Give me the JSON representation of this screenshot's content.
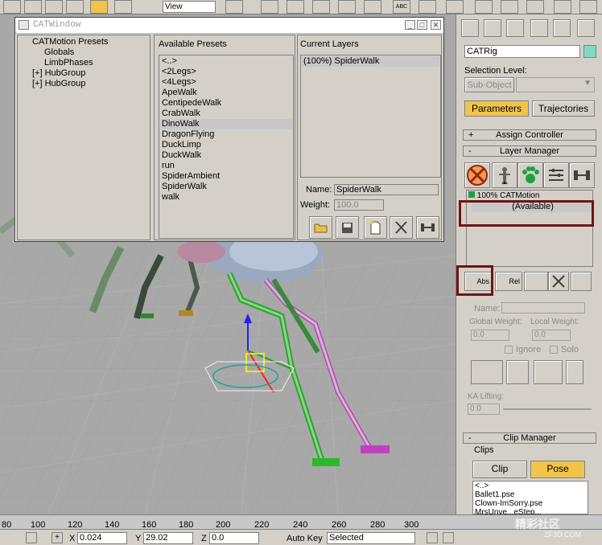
{
  "toolbar": {
    "view_combo": "View",
    "abc_label": "ABC"
  },
  "catwindow": {
    "title": "CATWindow",
    "minimize_icon": "minimize-icon",
    "maximize_icon": "maximize-icon",
    "close_icon": "close-icon",
    "tree": [
      "CATMotion Presets",
      "Globals",
      "LimbPhases",
      "[+] HubGroup",
      "[+] HubGroup"
    ],
    "presets_header": "Available Presets",
    "presets": [
      "<..>",
      "<2Legs>",
      "<4Legs>",
      "ApeWalk",
      "CentipedeWalk",
      "CrabWalk",
      "DinoWalk",
      "DragonFlying",
      "DuckLimp",
      "DuckWalk",
      "run",
      "SpiderAmbient",
      "SpiderWalk",
      "walk"
    ],
    "selected_preset": "DinoWalk",
    "layers_header": "Current Layers",
    "layers": [
      "(100%)  SpiderWalk"
    ],
    "name_label": "Name:",
    "name_value": "SpiderWalk",
    "weight_label": "Weight:",
    "weight_value": "100.0",
    "buttons": [
      "open-folder-icon",
      "save-icon",
      "new-icon",
      "delete-icon",
      "rig-icon"
    ]
  },
  "cmdpanel": {
    "object_name": "CATRig",
    "object_color": "#7fd9c4",
    "selection_level_label": "Selection Level:",
    "sub_object_label": "Sub-Object",
    "parameters_tab": "Parameters",
    "trajectories_tab": "Trajectories",
    "assign_controller": "Assign Controller",
    "layer_manager": "Layer Manager",
    "layer_list": [
      "100%  CATMotion",
      "(Available)"
    ],
    "abs_button": "Abs",
    "rel_button": "Rel",
    "name_label": "Name:",
    "global_weight_label": "Global Weight:",
    "local_weight_label": "Local Weight:",
    "global_weight_value": "0.0",
    "local_weight_value": "0.0",
    "ignore_label": "Ignore",
    "solo_label": "Solo",
    "ka_lifting_label": "KA Lifting:",
    "ka_lifting_value": "0.0",
    "clip_manager": "Clip Manager",
    "clips_label": "Clips",
    "clip_button": "Clip",
    "pose_button": "Pose",
    "clip_files": [
      "<..>",
      "Ballet1.pse",
      "Clown-ImSorry.pse",
      "MrsUnve...eStep..."
    ]
  },
  "ruler": {
    "ticks": [
      "80",
      "100",
      "120",
      "140",
      "160",
      "180",
      "200",
      "220",
      "240",
      "260",
      "280",
      "300"
    ]
  },
  "statusbar": {
    "x_label": "X",
    "x_value": "0.024",
    "y_label": "Y",
    "y_value": "29.02",
    "z_label": "Z",
    "z_value": "0.0",
    "autokey_label": "Auto Key",
    "selected_value": "Selected"
  },
  "watermark": {
    "text": "精彩社区",
    "sub": "ZF3D.COM"
  }
}
